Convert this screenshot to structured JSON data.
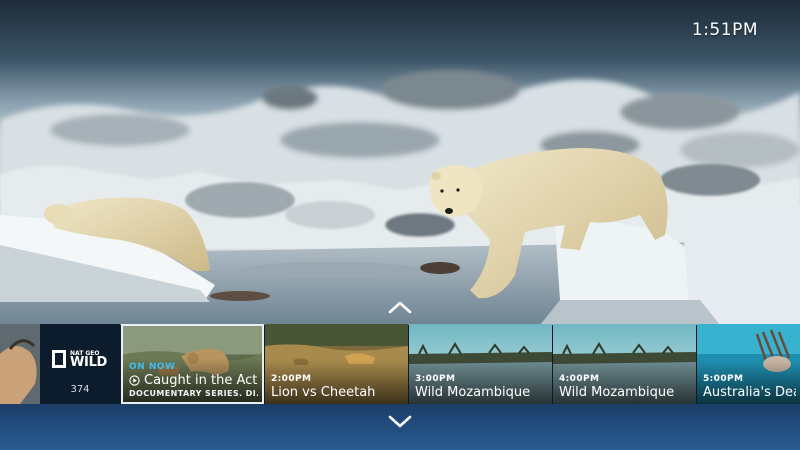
{
  "status": {
    "time": "1:51PM"
  },
  "channel": {
    "logo_top": "NAT GEO",
    "logo_main": "WILD",
    "number": "374"
  },
  "guide": {
    "current": {
      "badge": "ON NOW",
      "title": "Caught in the Act",
      "subtitle": "DOCUMENTARY SERIES. DI..."
    },
    "upcoming": [
      {
        "time": "2:00PM",
        "title": "Lion vs Cheetah"
      },
      {
        "time": "3:00PM",
        "title": "Wild Mozambique"
      },
      {
        "time": "4:00PM",
        "title": "Wild Mozambique"
      },
      {
        "time": "5:00PM",
        "title": "Australia's Dead"
      }
    ]
  },
  "icons": {
    "scroll_up": "chevron-up-icon",
    "scroll_down": "chevron-down-icon",
    "play": "play-circle-icon"
  },
  "colors": {
    "accent": "#3fbdf0",
    "text": "#ffffff",
    "band": "#1f4a7c"
  }
}
